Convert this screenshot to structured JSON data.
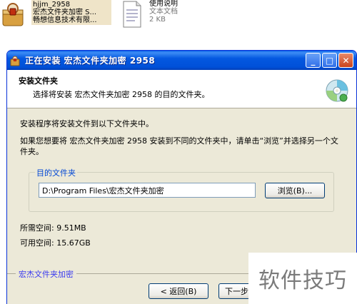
{
  "desktop": {
    "installer_file": {
      "line1": "hjjm_2958",
      "line2": "宏杰文件夹加密 S...",
      "line3": "畅想信息技术有限..."
    },
    "readme_file": {
      "name": "使用说明",
      "type": "文本文档",
      "size": "2 KB"
    }
  },
  "window": {
    "title": "正在安装 宏杰文件夹加密 2958",
    "header_title": "安装文件夹",
    "header_subtitle": "选择将安装 宏杰文件夹加密 2958 的目的文件夹。",
    "body_line1": "安装程序将安装文件到以下文件夹中。",
    "body_line2": "如果您想要将 宏杰文件夹加密 2958 安装到不同的文件夹中，请单击“浏览”并选择另一个文件夹。",
    "dest_group_label": "目的文件夹",
    "dest_path": "D:\\Program Files\\宏杰文件夹加密",
    "browse_label": "浏览(B)...",
    "space_required": "所需空间: 9.51MB",
    "space_available": "可用空间: 15.67GB",
    "footer_label": "宏杰文件夹加密",
    "back_label": "< 返回(B)",
    "next_label": "下一步"
  },
  "watermark": "软件技巧",
  "colors": {
    "titlebar": "#0050d8",
    "window_bg": "#ece9d8",
    "group_label": "#0046d5",
    "footer_label": "#3a3af0"
  },
  "icons": {
    "installer": "installer-package-icon",
    "readme": "text-document-icon",
    "header": "cd-disc-icon"
  }
}
